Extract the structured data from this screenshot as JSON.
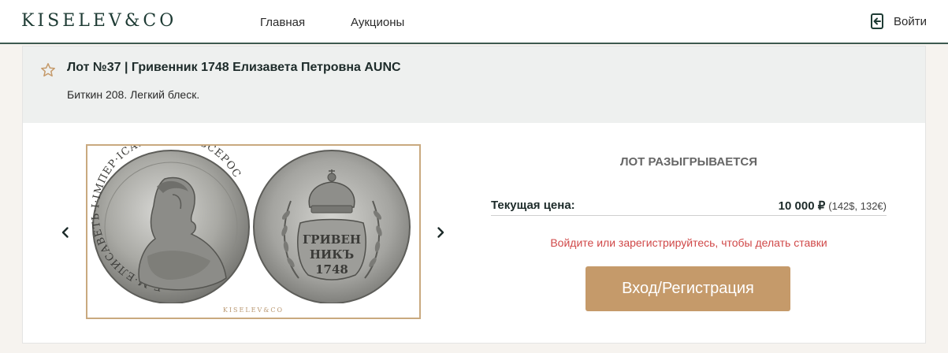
{
  "header": {
    "logo": "KISELEV&CO",
    "nav": [
      {
        "label": "Главная"
      },
      {
        "label": "Аукционы"
      }
    ],
    "login_label": "Войти",
    "login_icon": "login-door-icon",
    "accent_color": "#1e3b34"
  },
  "lot": {
    "title": "Лот №37 | Гривенник 1748 Елизавета Петровна AUNC",
    "description": "Биткин 208. Легкий блеск.",
    "favorite_icon": "star-outline-icon"
  },
  "gallery": {
    "watermark": "KISELEV&CO",
    "prev_icon": "chevron-left-icon",
    "next_icon": "chevron-right-icon",
    "obverse_legend": "Б·М·ЕЛИСАВЕТЬ·I·IMПЕР·IСАМОДЕРЖ·ВСЕРОС",
    "reverse_lines": [
      "ГРИВЕН",
      "НИКЪ",
      "1748"
    ]
  },
  "bid": {
    "status": "ЛОТ РАЗЫГРЫВАЕТСЯ",
    "price_label": "Текущая цена:",
    "price_value": "10 000 ₽",
    "price_converted": "(142$, 132€)",
    "notice": "Войдите или зарегистрируйтесь, чтобы делать ставки",
    "notice_color": "#d04848",
    "button_label": "Вход/Регистрация",
    "button_color": "#c59a6a"
  }
}
